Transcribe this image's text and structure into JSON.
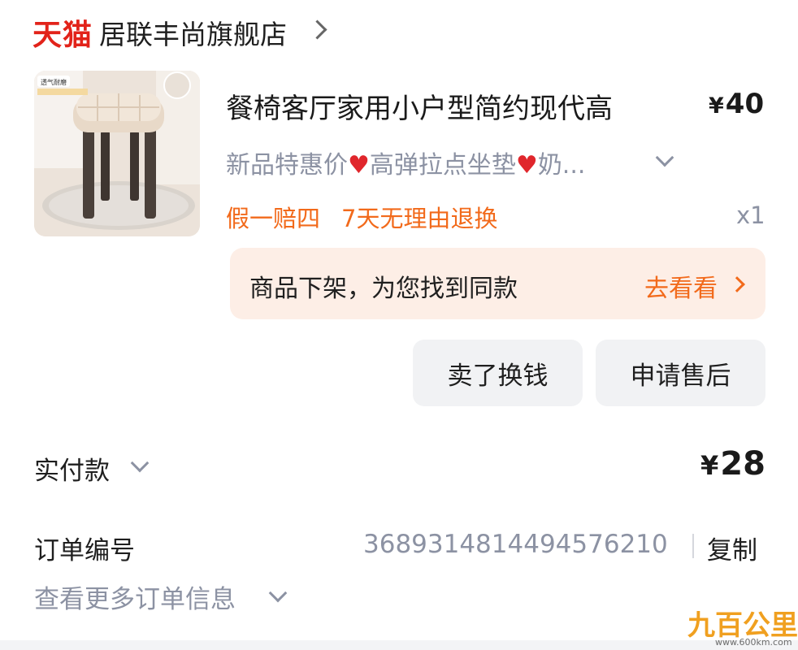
{
  "header": {
    "brand": "天猫",
    "shop_name": "居联丰尚旗舰店"
  },
  "product": {
    "title": "餐椅客厅家用小户型简约现代高",
    "price_symbol": "¥",
    "price": "40",
    "spec_part1": "新品特惠价",
    "spec_part2": "高弹拉点坐垫",
    "spec_part3": "奶...",
    "tag1": "假一赔四",
    "tag2": "7天无理由退换",
    "quantity": "x1",
    "thumb_badge": "透气耐磨"
  },
  "notice": {
    "text": "商品下架，为您找到同款",
    "link": "去看看"
  },
  "actions": {
    "sell": "卖了换钱",
    "after_sale": "申请售后"
  },
  "payment": {
    "label": "实付款",
    "symbol": "¥",
    "amount": "28"
  },
  "order": {
    "label": "订单编号",
    "number": "3689314814494576210",
    "copy": "复制",
    "more": "查看更多订单信息"
  },
  "watermark": {
    "text": "九百公里",
    "url": "www.600km.com"
  },
  "colors": {
    "brand_red": "#e2231a",
    "accent_orange": "#f26a1b",
    "muted_gray": "#8c92a3",
    "notice_bg": "#fdeee6",
    "button_bg": "#f1f2f4"
  }
}
